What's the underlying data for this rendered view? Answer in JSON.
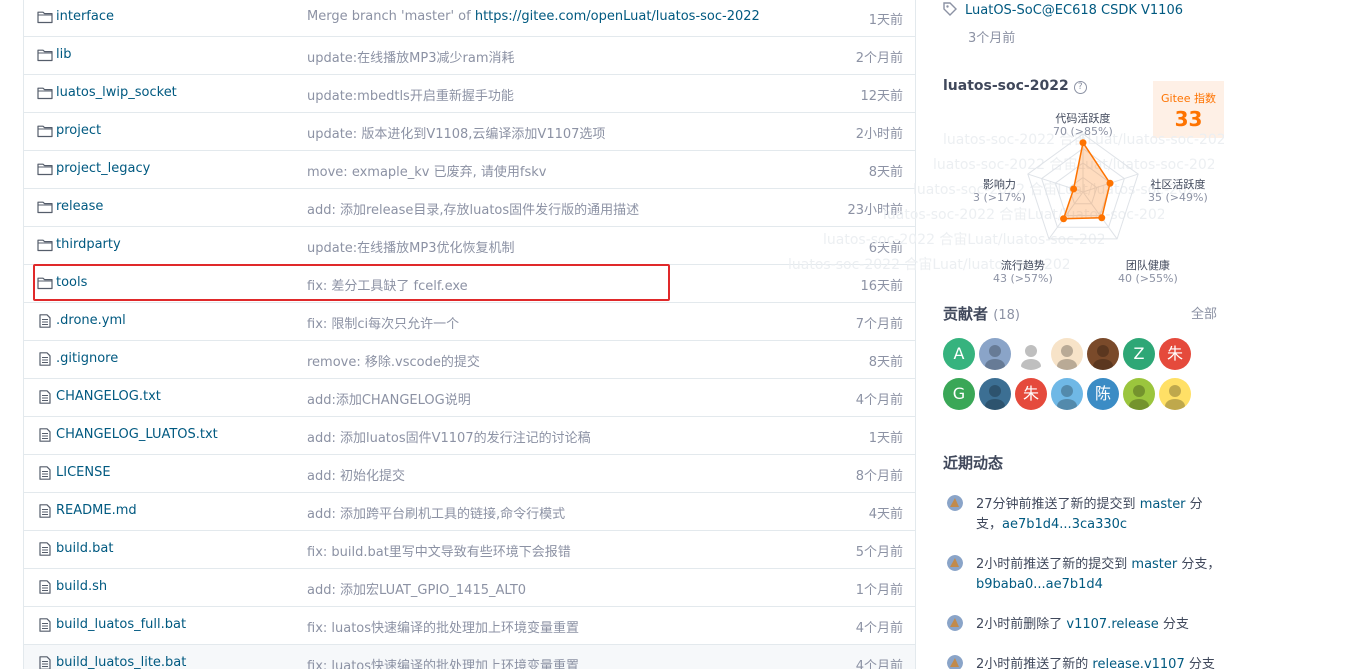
{
  "files": [
    {
      "name": "interface",
      "type": "folder",
      "message": "Merge branch 'master' of ",
      "message_link": "https://gitee.com/openLuat/luatos-soc-2022",
      "time": "1天前"
    },
    {
      "name": "lib",
      "type": "folder",
      "message": "update:在线播放MP3减少ram消耗",
      "message_link": "",
      "time": "2个月前"
    },
    {
      "name": "luatos_lwip_socket",
      "type": "folder",
      "message": "update:mbedtls开启重新握手功能",
      "message_link": "",
      "time": "12天前"
    },
    {
      "name": "project",
      "type": "folder",
      "message": "update: 版本进化到V1108,云编译添加V1107选项",
      "message_link": "",
      "time": "2小时前"
    },
    {
      "name": "project_legacy",
      "type": "folder",
      "message": "move: exmaple_kv 已废弃, 请使用fskv",
      "message_link": "",
      "time": "8天前"
    },
    {
      "name": "release",
      "type": "folder",
      "message": "add: 添加release目录,存放luatos固件发行版的通用描述",
      "message_link": "",
      "time": "23小时前"
    },
    {
      "name": "thirdparty",
      "type": "folder",
      "message": "update:在线播放MP3优化恢复机制",
      "message_link": "",
      "time": "6天前"
    },
    {
      "name": "tools",
      "type": "folder",
      "message": "fix: 差分工具缺了 fcelf.exe",
      "message_link": "",
      "time": "16天前"
    },
    {
      "name": ".drone.yml",
      "type": "file",
      "message": "fix: 限制ci每次只允许一个",
      "message_link": "",
      "time": "7个月前"
    },
    {
      "name": ".gitignore",
      "type": "file",
      "message": "remove: 移除.vscode的提交",
      "message_link": "",
      "time": "8天前"
    },
    {
      "name": "CHANGELOG.txt",
      "type": "file",
      "message": "add:添加CHANGELOG说明",
      "message_link": "",
      "time": "4个月前"
    },
    {
      "name": "CHANGELOG_LUATOS.txt",
      "type": "file",
      "message": "add: 添加luatos固件V1107的发行注记的讨论稿",
      "message_link": "",
      "time": "1天前"
    },
    {
      "name": "LICENSE",
      "type": "file",
      "message": "add: 初始化提交",
      "message_link": "",
      "time": "8个月前"
    },
    {
      "name": "README.md",
      "type": "file",
      "message": "add: 添加跨平台刷机工具的链接,命令行模式",
      "message_link": "",
      "time": "4天前"
    },
    {
      "name": "build.bat",
      "type": "file",
      "message": "fix: build.bat里写中文导致有些环境下会报错",
      "message_link": "",
      "time": "5个月前"
    },
    {
      "name": "build.sh",
      "type": "file",
      "message": "add: 添加宏LUAT_GPIO_1415_ALT0",
      "message_link": "",
      "time": "1个月前"
    },
    {
      "name": "build_luatos_full.bat",
      "type": "file",
      "message": "fix: luatos快速编译的批处理加上环境变量重置",
      "message_link": "",
      "time": "4个月前"
    },
    {
      "name": "build_luatos_lite.bat",
      "type": "file",
      "message": "fix: luatos快速编译的批处理加上环境变量重置",
      "message_link": "",
      "time": "4个月前"
    }
  ],
  "highlighted_file": "tools",
  "sidebar": {
    "release": {
      "name": "LuatOS-SoC@EC618 CSDK V1106",
      "time": "3个月前"
    },
    "gitee_index": {
      "repo": "luatos-soc-2022",
      "help": "?",
      "badge_label": "Gitee 指数",
      "score": "33",
      "watermark_text": "luatos-soc-2022 合宙Luat/luatos-soc-2022 合宙Luat/",
      "metrics": [
        {
          "label": "代码活跃度",
          "value": "70 (>85%)",
          "score": 0.85
        },
        {
          "label": "社区活跃度",
          "value": "35 (>49%)",
          "score": 0.49
        },
        {
          "label": "团队健康",
          "value": "40 (>55%)",
          "score": 0.55
        },
        {
          "label": "流行趋势",
          "value": "43 (>57%)",
          "score": 0.57
        },
        {
          "label": "影响力",
          "value": "3 (>17%)",
          "score": 0.17
        }
      ]
    },
    "contributors": {
      "title": "贡献者",
      "count": "(18)",
      "all_label": "全部",
      "avatars": [
        {
          "text": "A",
          "color": "#36b37e",
          "kind": "letter"
        },
        {
          "text": "",
          "color": "#8aa4c8",
          "kind": "icon"
        },
        {
          "text": "",
          "color": "#ffffff",
          "kind": "icon"
        },
        {
          "text": "",
          "color": "#f7e3c8",
          "kind": "icon"
        },
        {
          "text": "",
          "color": "#7a4a2a",
          "kind": "icon"
        },
        {
          "text": "Z",
          "color": "#2ea776",
          "kind": "letter"
        },
        {
          "text": "朱",
          "color": "#e54a3c",
          "kind": "letter"
        },
        {
          "text": "G",
          "color": "#3aa757",
          "kind": "letter"
        },
        {
          "text": "",
          "color": "#3c6f93",
          "kind": "icon"
        },
        {
          "text": "朱",
          "color": "#e54a3c",
          "kind": "letter"
        },
        {
          "text": "",
          "color": "#6fb8e6",
          "kind": "icon"
        },
        {
          "text": "陈",
          "color": "#3b8cc5",
          "kind": "letter"
        },
        {
          "text": "",
          "color": "#9bc53d",
          "kind": "icon"
        },
        {
          "text": "",
          "color": "#ffe066",
          "kind": "icon"
        }
      ]
    },
    "recent": {
      "title": "近期动态",
      "events": [
        {
          "pre": "27分钟前推送了新的提交到 ",
          "ref": "master",
          "mid": " 分支，",
          "ref2": "ae7b1d4...3ca330c"
        },
        {
          "pre": "2小时前推送了新的提交到 ",
          "ref": "master",
          "mid": " 分支，",
          "ref2": "b9baba0...ae7b1d4"
        },
        {
          "pre": "2小时前删除了 ",
          "ref": "v1107.release",
          "mid": " 分支",
          "ref2": ""
        },
        {
          "pre": "2小时前推送了新的 ",
          "ref": "release.v1107",
          "mid": " 分支",
          "ref2": ""
        }
      ]
    }
  }
}
